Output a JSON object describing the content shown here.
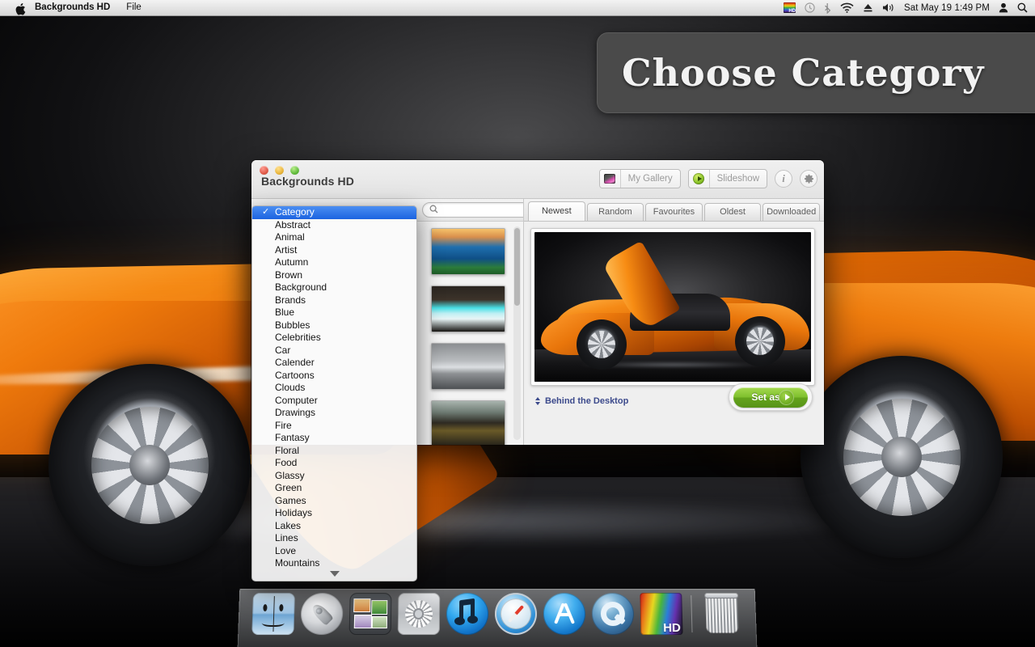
{
  "menubar": {
    "apple_icon": "apple-logo-icon",
    "app_name": "Backgrounds HD",
    "menus": [
      "File"
    ],
    "status_icons": [
      "rainbow-hd-icon",
      "clock-icon",
      "bluetooth-icon",
      "wifi-icon",
      "eject-icon",
      "volume-icon"
    ],
    "clock": "Sat May 19  1:49 PM",
    "user_icon": "user-icon",
    "spotlight_icon": "search-icon"
  },
  "banner": {
    "text": "Choose Category",
    "bg_color": "#4a4a4a",
    "text_color": "#f2f2f2"
  },
  "window": {
    "title": "Backgrounds HD",
    "traffic_lights": [
      "close",
      "minimize",
      "zoom"
    ],
    "toolbar": {
      "my_gallery_label": "My Gallery",
      "my_gallery_icon": "gallery-thumbnail-icon",
      "slideshow_label": "Slideshow",
      "slideshow_icon": "play-circle-icon",
      "info_icon": "info-icon",
      "settings_icon": "gear-icon"
    },
    "search": {
      "placeholder": "",
      "value": "",
      "icon": "search-icon"
    },
    "stepper_icon": "up-down-stepper-icon",
    "thumbnails": [
      {
        "name": "sunset-lake-thumbnail",
        "class": "th-sunset"
      },
      {
        "name": "cave-beach-thumbnail",
        "class": "th-cave"
      },
      {
        "name": "silver-car-thumbnail",
        "class": "th-silvercar"
      },
      {
        "name": "valley-night-thumbnail",
        "class": "th-valley"
      }
    ],
    "tabs": [
      {
        "label": "Newest",
        "active": true
      },
      {
        "label": "Random",
        "active": false
      },
      {
        "label": "Favourites",
        "active": false
      },
      {
        "label": "Oldest",
        "active": false
      },
      {
        "label": "Downloaded",
        "active": false
      }
    ],
    "preview": {
      "name": "orange-sports-car-preview"
    },
    "behind_desktop_label": "Behind the Desktop",
    "set_as_label": "Set as",
    "set_as_arrow_icon": "arrow-right-circle-icon",
    "accent_green": "#7fc02e",
    "link_blue": "#3c4a8c"
  },
  "dropdown": {
    "selected": "Category",
    "check_glyph": "✓",
    "scroll_down_icon": "scroll-down-arrow-icon",
    "highlight_color": "#1c63e0",
    "items": [
      "Category",
      "Abstract",
      "Animal",
      "Artist",
      "Autumn",
      "Brown",
      "Background",
      "Brands",
      "Blue",
      "Bubbles",
      "Celebrities",
      "Car",
      "Calender",
      "Cartoons",
      "Clouds",
      "Computer",
      "Drawings",
      "Fire",
      "Fantasy",
      "Floral",
      "Food",
      "Glassy",
      "Green",
      "Games",
      "Holidays",
      "Lakes",
      "Lines",
      "Love",
      "Mountains"
    ]
  },
  "dock": {
    "items": [
      {
        "name": "finder",
        "class": "finder",
        "shape": "rect"
      },
      {
        "name": "launchpad",
        "class": "launchpad",
        "shape": "circle"
      },
      {
        "name": "iphoto",
        "class": "iphoto",
        "shape": "rect"
      },
      {
        "name": "system-preferences",
        "class": "syspref",
        "shape": "rect"
      },
      {
        "name": "itunes",
        "class": "itunes",
        "shape": "circle"
      },
      {
        "name": "safari",
        "class": "safari",
        "shape": "circle"
      },
      {
        "name": "app-store",
        "class": "appstore",
        "shape": "circle"
      },
      {
        "name": "quicktime",
        "class": "quicktime",
        "shape": "circle"
      },
      {
        "name": "backgrounds-hd",
        "class": "bghd",
        "shape": "rect"
      },
      {
        "name": "trash",
        "class": "trash",
        "shape": "trash"
      }
    ]
  }
}
